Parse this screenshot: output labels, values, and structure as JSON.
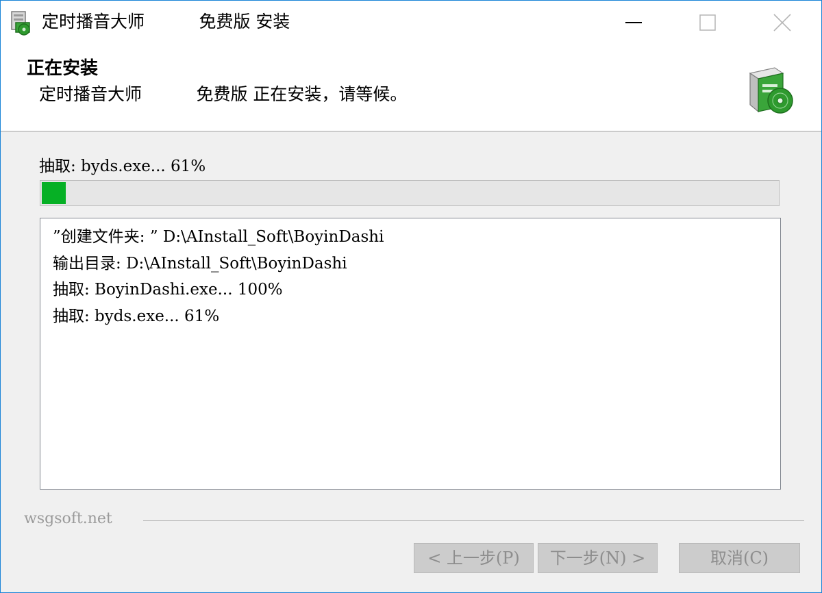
{
  "window": {
    "title": "定时播音大师          免费版 安装",
    "app_icon": "installer-box-icon",
    "controls": {
      "minimize": "minimize-icon",
      "maximize": "maximize-icon",
      "close": "close-icon"
    }
  },
  "header": {
    "title": "正在安装",
    "subtitle": "定时播音大师          免费版 正在安装，请等候。",
    "icon": "installer-cd-box-icon"
  },
  "progress": {
    "status_text": "抽取: byds.exe... 61%",
    "bar_fraction": 0.033,
    "bar_color": "#06b025"
  },
  "log": {
    "lines": [
      "”创建文件夹: ” D:\\AInstall_Soft\\BoyinDashi",
      "输出目录: D:\\AInstall_Soft\\BoyinDashi",
      "抽取: BoyinDashi.exe... 100%",
      "抽取: byds.exe... 61%"
    ]
  },
  "branding": {
    "text": "wsgsoft.net"
  },
  "buttons": {
    "back": "< 上一步(P)",
    "next": "下一步(N) >",
    "cancel": "取消(C)"
  },
  "colors": {
    "accent_border": "#1883d7",
    "progress_green": "#06b025",
    "dialog_bg": "#f0f0f0"
  }
}
